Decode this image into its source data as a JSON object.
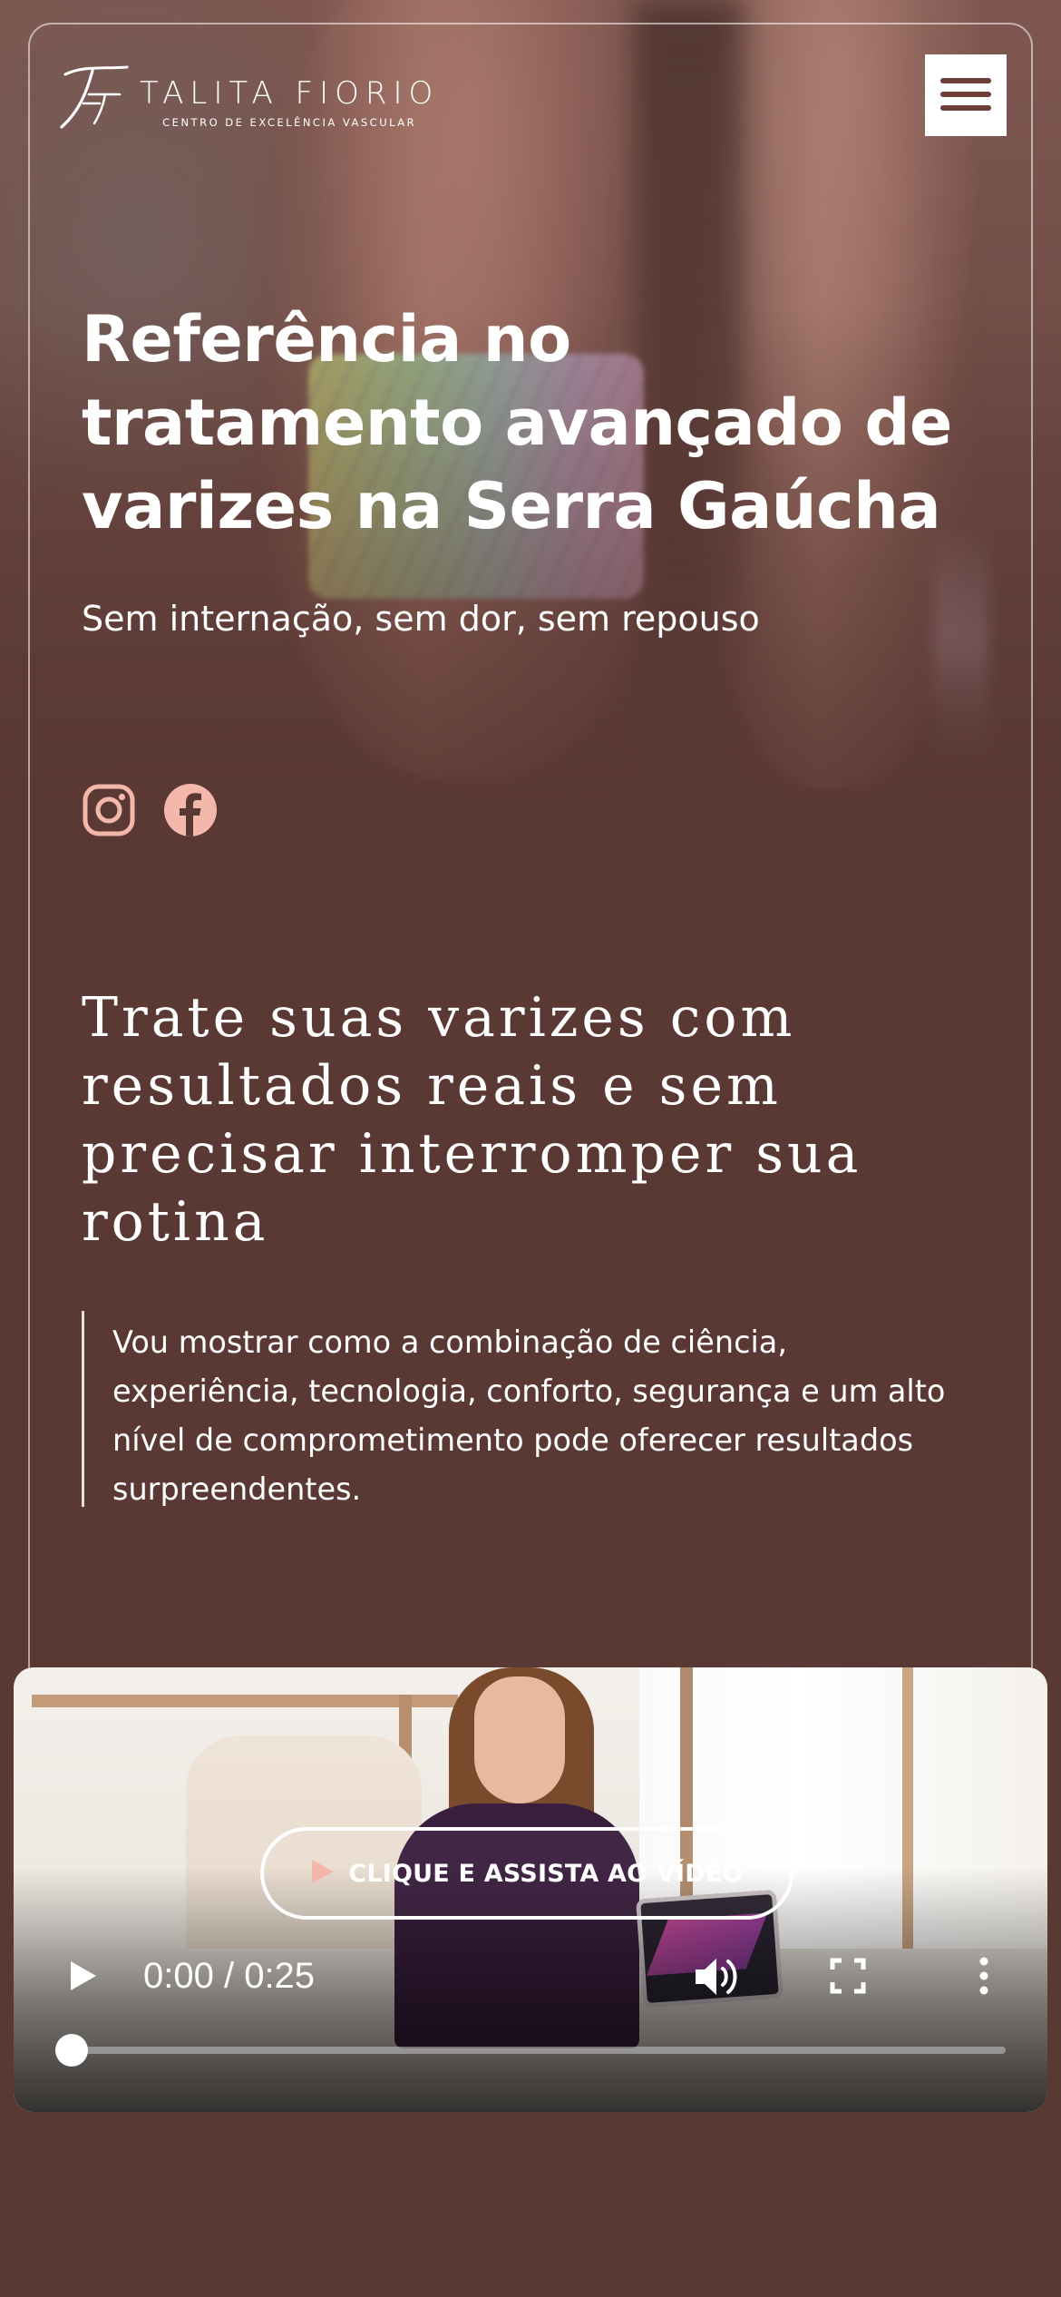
{
  "brand": {
    "name": "TALITA FIORIO",
    "tagline": "CENTRO DE EXCELÊNCIA VASCULAR",
    "monogram": "TF"
  },
  "header": {
    "menu_icon": "hamburger-icon"
  },
  "hero": {
    "title": "Referência no tratamento avançado de varizes na Serra Gaúcha",
    "subtitle": "Sem internação, sem dor, sem repouso",
    "social": [
      {
        "name": "instagram",
        "icon": "instagram-icon"
      },
      {
        "name": "facebook",
        "icon": "facebook-icon"
      }
    ]
  },
  "intro": {
    "heading": "Trate suas varizes com resultados reais e sem precisar interromper sua rotina",
    "quote": "Vou mostrar como a combinação de ciência, experiência, tecnologia, conforto, segurança e um alto nível de comprometimento pode oferecer resultados surpreendentes."
  },
  "video": {
    "cta_label": "CLIQUE E ASSISTA AO VÍDEO",
    "time_display": "0:00 / 0:25",
    "progress": 0,
    "icons": [
      "play-icon",
      "volume-icon",
      "fullscreen-icon",
      "more-options-icon"
    ]
  },
  "colors": {
    "background": "#5a3833",
    "accent_pink": "#f4b8ab",
    "text": "#ffffff"
  }
}
